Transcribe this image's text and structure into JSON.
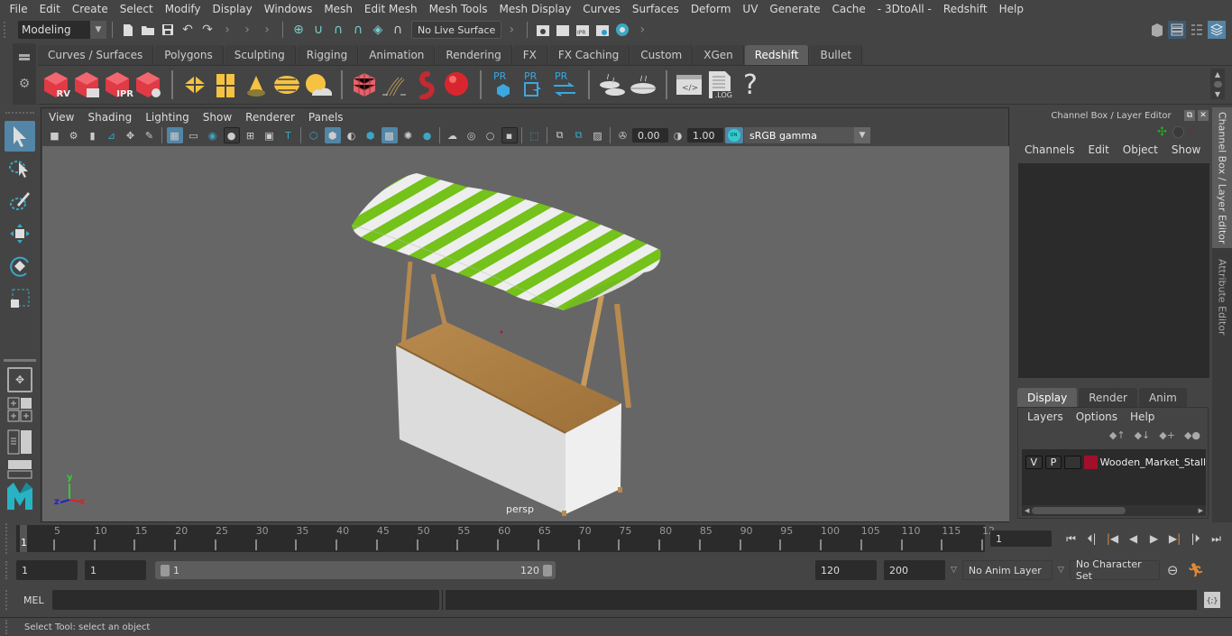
{
  "menubar": {
    "items": [
      "File",
      "Edit",
      "Create",
      "Select",
      "Modify",
      "Display",
      "Windows",
      "Mesh",
      "Edit Mesh",
      "Mesh Tools",
      "Mesh Display",
      "Curves",
      "Surfaces",
      "Deform",
      "UV",
      "Generate",
      "Cache",
      "- 3DtoAll -",
      "Redshift",
      "Help"
    ]
  },
  "statusline": {
    "mode": "Modeling",
    "live_surface": "No Live Surface"
  },
  "shelf": {
    "tabs": [
      "Curves / Surfaces",
      "Polygons",
      "Sculpting",
      "Rigging",
      "Animation",
      "Rendering",
      "FX",
      "FX Caching",
      "Custom",
      "XGen",
      "Redshift",
      "Bullet"
    ],
    "active_tab": "Redshift",
    "icon_labels": {
      "rv": "RV",
      "ipr": "IPR",
      "pr": "PR",
      "log": ".LOG",
      "help": "?"
    }
  },
  "viewport": {
    "menu": [
      "View",
      "Shading",
      "Lighting",
      "Show",
      "Renderer",
      "Panels"
    ],
    "exposure": "0.00",
    "gamma": "1.00",
    "color_mgmt_badge": "ON",
    "colorspace": "sRGB gamma",
    "camera_label": "persp",
    "axis_labels": {
      "x": "x",
      "y": "y",
      "z": "z"
    }
  },
  "channelbox": {
    "title": "Channel Box / Layer Editor",
    "menu": [
      "Channels",
      "Edit",
      "Object",
      "Show"
    ],
    "layer_tabs": [
      "Display",
      "Render",
      "Anim"
    ],
    "active_layer_tab": "Display",
    "layer_menu": [
      "Layers",
      "Options",
      "Help"
    ],
    "layers": [
      {
        "v": "V",
        "p": "P",
        "color": "#a0102a",
        "name": "Wooden_Market_Stall"
      }
    ]
  },
  "sidetabs": [
    "Channel Box / Layer Editor",
    "Attribute Editor"
  ],
  "timeline": {
    "ticks": [
      5,
      10,
      15,
      20,
      25,
      30,
      35,
      40,
      45,
      50,
      55,
      60,
      65,
      70,
      75,
      80,
      85,
      90,
      95,
      100,
      105,
      110,
      115,
      "12"
    ],
    "current_frame_marker": "1",
    "current_frame": "1"
  },
  "range": {
    "start": "1",
    "playback_start": "1",
    "slider_min_label": "1",
    "slider_max_label": "120",
    "playback_end": "120",
    "end": "200",
    "anim_layer": "No Anim Layer",
    "character_set": "No Character Set"
  },
  "commandline": {
    "lang": "MEL",
    "input": "",
    "output": ""
  },
  "helpline": {
    "text": "Select Tool: select an object"
  }
}
